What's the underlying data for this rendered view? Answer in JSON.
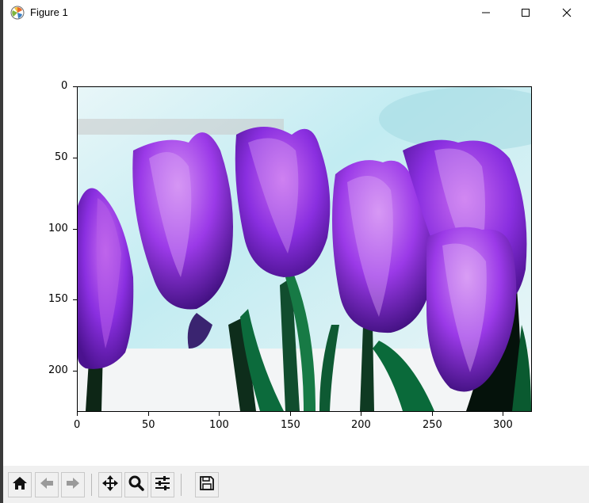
{
  "window": {
    "title": "Figure 1",
    "icon": "matplotlib-icon",
    "controls": [
      "minimize-icon",
      "maximize-icon",
      "close-icon"
    ]
  },
  "plot": {
    "image_subject": "purple tulips",
    "x_ticks": [
      "0",
      "50",
      "100",
      "150",
      "200",
      "250",
      "300"
    ],
    "y_ticks": [
      "0",
      "50",
      "100",
      "150",
      "200"
    ],
    "x_range": [
      0,
      320
    ],
    "y_range": [
      229,
      0
    ]
  },
  "toolbar": {
    "buttons": [
      {
        "name": "home-button",
        "icon": "home-icon"
      },
      {
        "name": "back-button",
        "icon": "arrow-left-icon"
      },
      {
        "name": "forward-button",
        "icon": "arrow-right-icon"
      },
      {
        "name": "pan-button",
        "icon": "move-icon"
      },
      {
        "name": "zoom-button",
        "icon": "magnifier-icon"
      },
      {
        "name": "configure-subplots-button",
        "icon": "sliders-icon"
      },
      {
        "name": "save-button",
        "icon": "floppy-disk-icon"
      }
    ]
  }
}
